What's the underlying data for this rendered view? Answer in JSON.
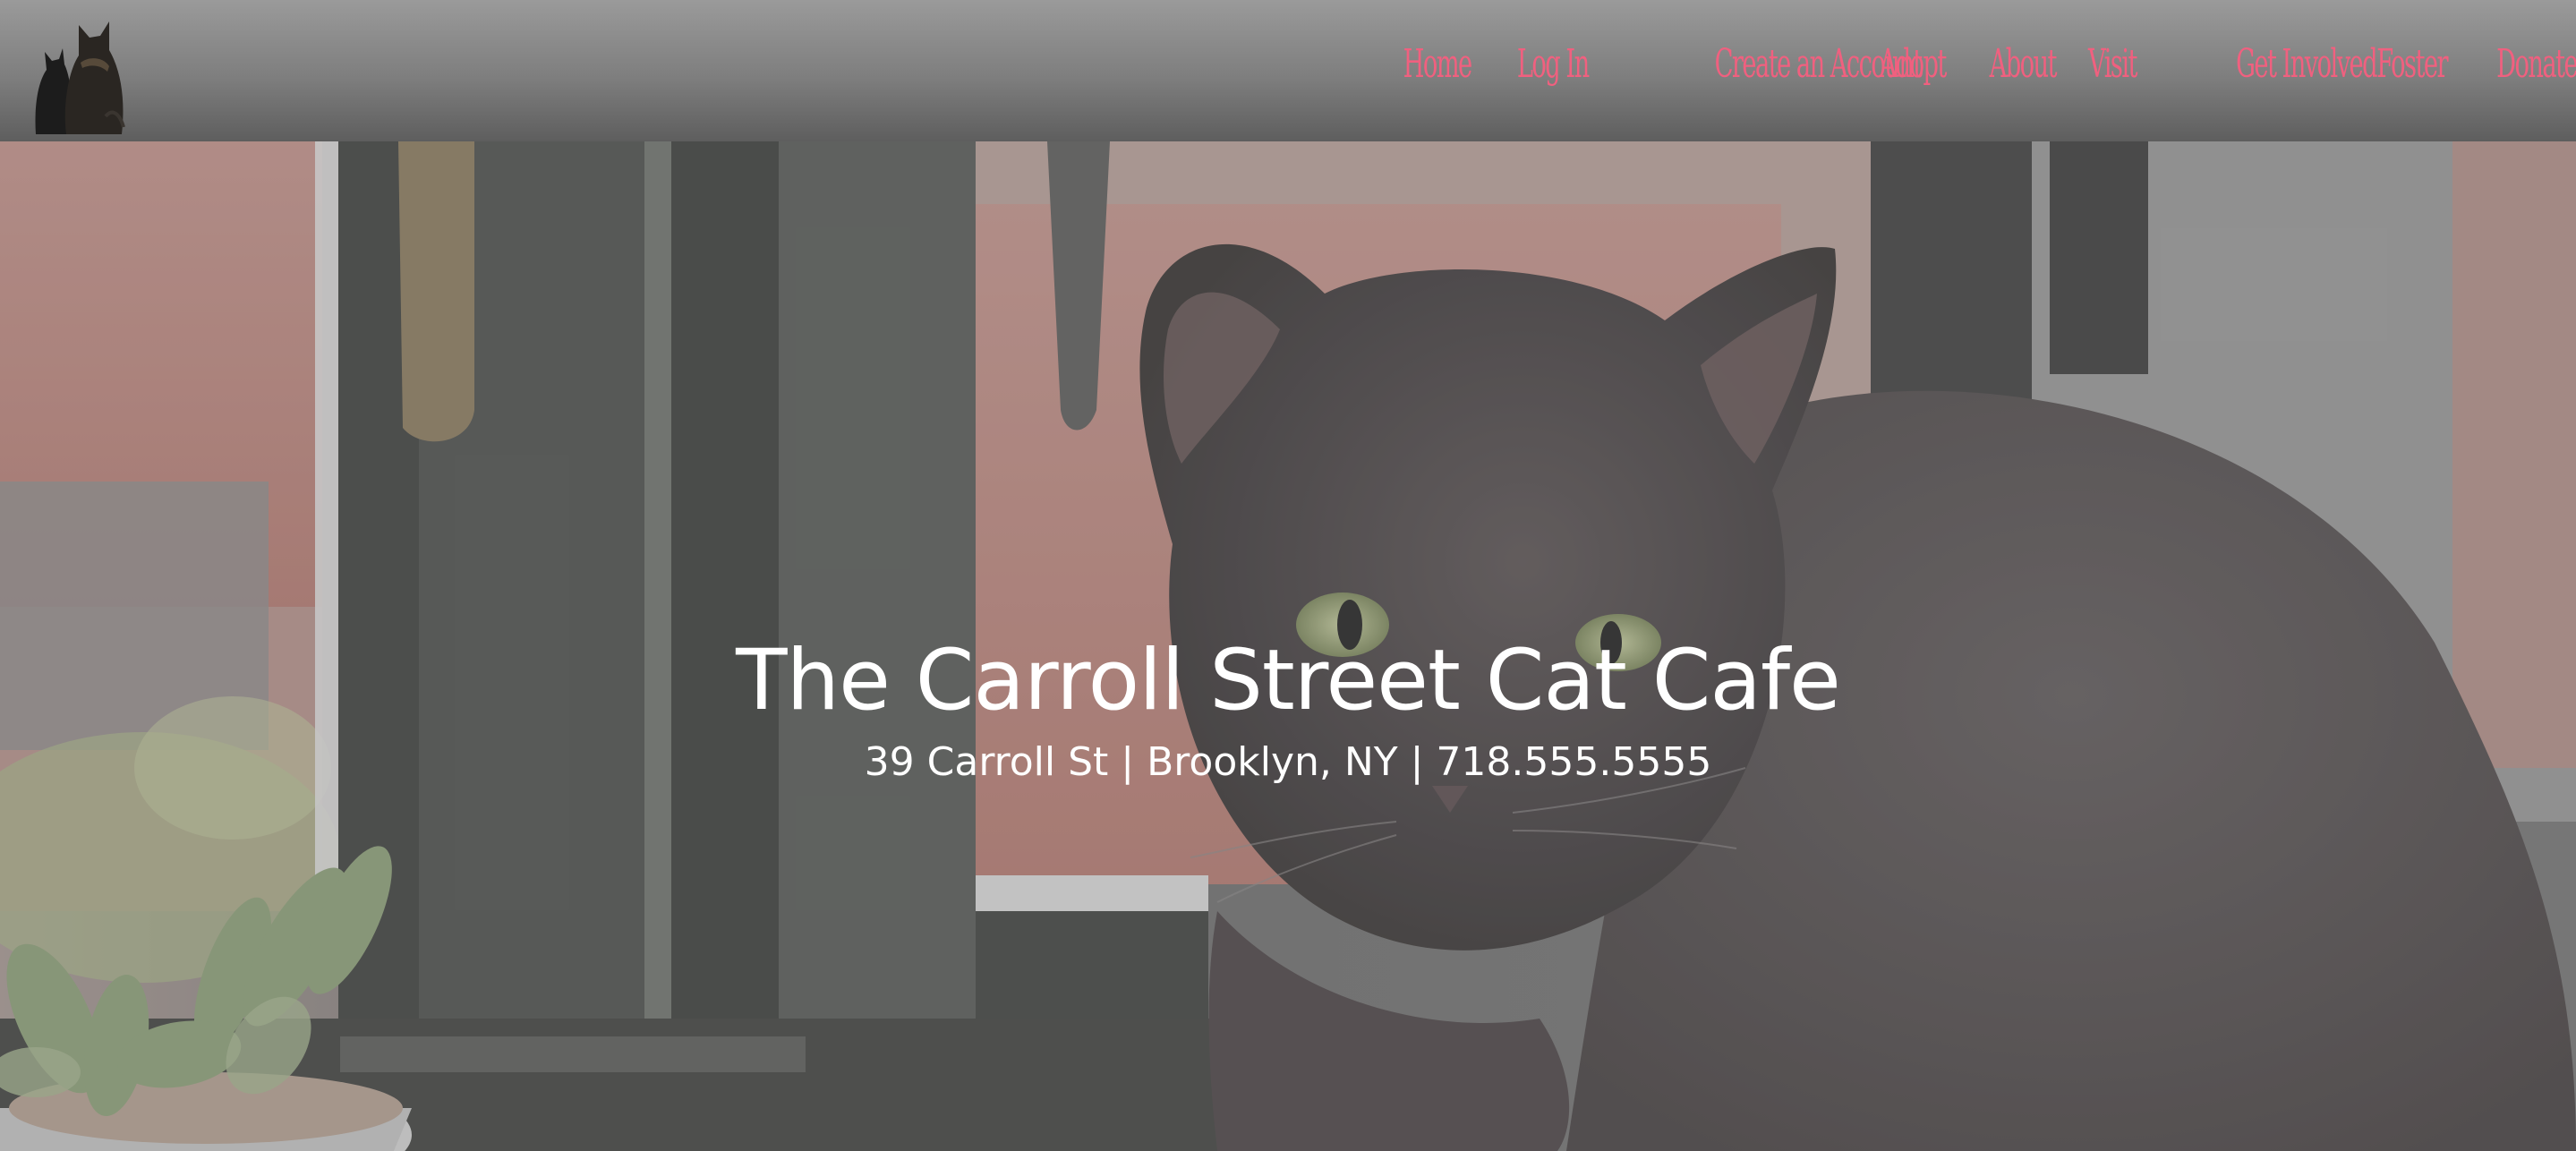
{
  "nav": {
    "logo_icon": "two-cats-silhouette-icon",
    "items": [
      {
        "label": "Home"
      },
      {
        "label": "Log In"
      },
      {
        "label": "Create an Account"
      },
      {
        "label": "Adopt"
      },
      {
        "label": "About"
      },
      {
        "label": "Visit"
      },
      {
        "label": "Get Involved"
      },
      {
        "label": "Foster"
      },
      {
        "label": "Donate"
      }
    ],
    "link_color": "#f0607f"
  },
  "hero": {
    "title": "The Carroll Street Cat Cafe",
    "subtitle": "39 Carroll St | Brooklyn, NY | 718.555.5555",
    "image": "black-cat-by-window-photo"
  }
}
